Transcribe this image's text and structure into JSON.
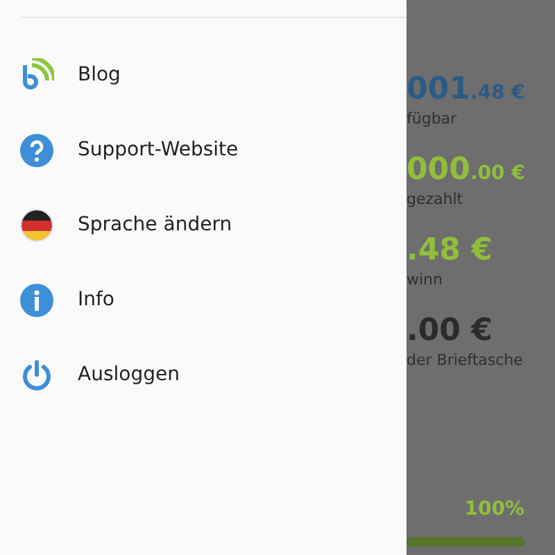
{
  "drawer": {
    "items": [
      {
        "kind": "blog",
        "label": "Blog"
      },
      {
        "kind": "help",
        "label": "Support-Website"
      },
      {
        "kind": "flag",
        "label": "Sprache ändern"
      },
      {
        "kind": "info",
        "label": "Info"
      },
      {
        "kind": "power",
        "label": "Ausloggen"
      }
    ]
  },
  "background": {
    "stats": [
      {
        "amount": "001",
        "fraction": ".48 €",
        "label": "fügbar",
        "color": "#2a5b87"
      },
      {
        "amount": "000",
        "fraction": ".00 €",
        "label": "gezahlt",
        "color": "#8fbf3a"
      },
      {
        "amount": ".48 €",
        "label": "winn",
        "color": "#8fbf3a"
      },
      {
        "amount": ".00 €",
        "label": "der Brieftasche",
        "color": "#2b2b2b"
      }
    ],
    "progress": {
      "reading": "100%",
      "level": 1
    }
  }
}
